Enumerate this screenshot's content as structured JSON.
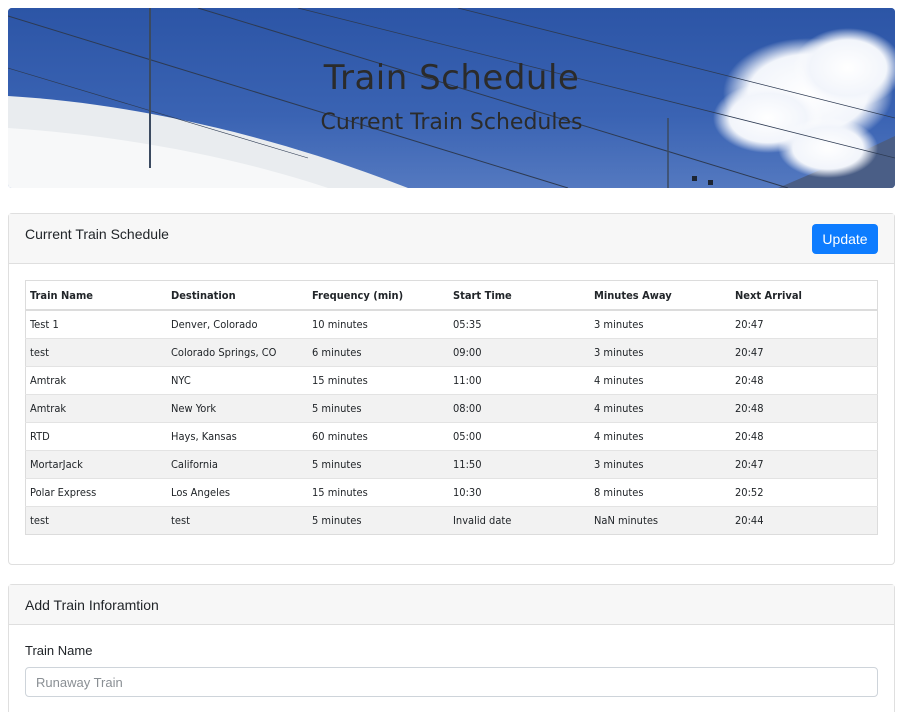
{
  "banner": {
    "title": "Train Schedule",
    "subtitle": "Current Train Schedules"
  },
  "schedule_card": {
    "header": "Current Train Schedule",
    "update_label": "Update",
    "columns": [
      "Train Name",
      "Destination",
      "Frequency (min)",
      "Start Time",
      "Minutes Away",
      "Next Arrival"
    ],
    "rows": [
      [
        "Test 1",
        "Denver, Colorado",
        "10 minutes",
        "05:35",
        "3 minutes",
        "20:47"
      ],
      [
        "test",
        "Colorado Springs, CO",
        "6 minutes",
        "09:00",
        "3 minutes",
        "20:47"
      ],
      [
        "Amtrak",
        "NYC",
        "15 minutes",
        "11:00",
        "4 minutes",
        "20:48"
      ],
      [
        "Amtrak",
        "New York",
        "5 minutes",
        "08:00",
        "4 minutes",
        "20:48"
      ],
      [
        "RTD",
        "Hays, Kansas",
        "60 minutes",
        "05:00",
        "4 minutes",
        "20:48"
      ],
      [
        "MortarJack",
        "California",
        "5 minutes",
        "11:50",
        "3 minutes",
        "20:47"
      ],
      [
        "Polar Express",
        "Los Angeles",
        "15 minutes",
        "10:30",
        "8 minutes",
        "20:52"
      ],
      [
        "test",
        "test",
        "5 minutes",
        "Invalid date",
        "NaN minutes",
        "20:44"
      ]
    ]
  },
  "add_card": {
    "header": "Add Train Inforamtion",
    "train_name_label": "Train Name",
    "train_name_placeholder": "Runaway Train"
  },
  "colors": {
    "primary_button": "#0d7cff",
    "sky": "#3c64b4"
  }
}
